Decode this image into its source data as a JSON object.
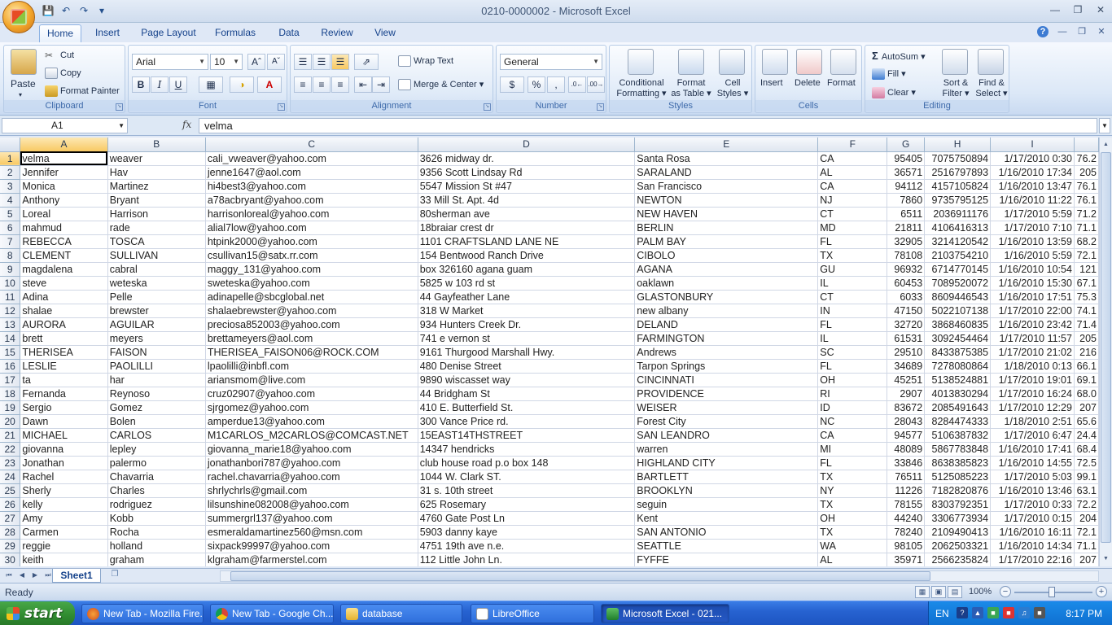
{
  "window": {
    "title": "0210-0000002 - Microsoft Excel"
  },
  "tabs": [
    "Home",
    "Insert",
    "Page Layout",
    "Formulas",
    "Data",
    "Review",
    "View"
  ],
  "ribbon": {
    "clipboard": {
      "label": "Clipboard",
      "paste": "Paste",
      "cut": "Cut",
      "copy": "Copy",
      "format_painter": "Format Painter"
    },
    "font": {
      "label": "Font",
      "font_name": "Arial",
      "font_size": "10",
      "bold": "B",
      "italic": "I",
      "underline": "U"
    },
    "alignment": {
      "label": "Alignment",
      "wrap_text": "Wrap Text",
      "merge_center": "Merge & Center"
    },
    "number": {
      "label": "Number",
      "format": "General",
      "currency": "$",
      "percent": "%",
      "comma": ","
    },
    "styles": {
      "label": "Styles",
      "conditional_1": "Conditional",
      "conditional_2": "Formatting",
      "format_table_1": "Format",
      "format_table_2": "as Table",
      "cell_styles_1": "Cell",
      "cell_styles_2": "Styles"
    },
    "cells": {
      "label": "Cells",
      "insert": "Insert",
      "delete": "Delete",
      "format": "Format"
    },
    "editing": {
      "label": "Editing",
      "autosum": "AutoSum",
      "fill": "Fill",
      "clear": "Clear",
      "sort_1": "Sort &",
      "sort_2": "Filter",
      "find_1": "Find &",
      "find_2": "Select"
    }
  },
  "formula_bar": {
    "name_box": "A1",
    "fx": "fx",
    "value": "velma"
  },
  "columns": [
    "A",
    "B",
    "C",
    "D",
    "E",
    "F",
    "G",
    "H",
    "I",
    ""
  ],
  "rows": [
    [
      "velma",
      "weaver",
      "cali_vweaver@yahoo.com",
      "3626 midway dr.",
      "Santa Rosa",
      "CA",
      "95405",
      "7075750894",
      "1/17/2010 0:30",
      "76.2"
    ],
    [
      "Jennifer",
      "Hav",
      "jenne1647@aol.com",
      "9356 Scott Lindsay Rd",
      "SARALAND",
      "AL",
      "36571",
      "2516797893",
      "1/16/2010 17:34",
      "205"
    ],
    [
      "Monica",
      "Martinez",
      "hi4best3@yahoo.com",
      "5547 Mission St #47",
      "San Francisco",
      "CA",
      "94112",
      "4157105824",
      "1/16/2010 13:47",
      "76.1"
    ],
    [
      "Anthony",
      "Bryant",
      "a78acbryant@yahoo.com",
      "33 Mill St. Apt. 4d",
      "NEWTON",
      "NJ",
      "7860",
      "9735795125",
      "1/16/2010 11:22",
      "76.1"
    ],
    [
      "Loreal",
      "Harrison",
      "harrisonloreal@yahoo.com",
      "80sherman ave",
      "NEW HAVEN",
      "CT",
      "6511",
      "2036911176",
      "1/17/2010 5:59",
      "71.2"
    ],
    [
      "mahmud",
      "rade",
      "alial7low@yahoo.com",
      "18braiar crest dr",
      "BERLIN",
      "MD",
      "21811",
      "4106416313",
      "1/17/2010 7:10",
      "71.1"
    ],
    [
      "REBECCA",
      "TOSCA",
      "htpink2000@yahoo.com",
      "1101 CRAFTSLAND LANE NE",
      "PALM BAY",
      "FL",
      "32905",
      "3214120542",
      "1/16/2010 13:59",
      "68.2"
    ],
    [
      "CLEMENT",
      "SULLIVAN",
      "csullivan15@satx.rr.com",
      "154 Bentwood Ranch Drive",
      "CIBOLO",
      "TX",
      "78108",
      "2103754210",
      "1/16/2010 5:59",
      "72.1"
    ],
    [
      "magdalena",
      "cabral",
      "maggy_131@yahoo.com",
      "box 326160 agana guam",
      "AGANA",
      "GU",
      "96932",
      "6714770145",
      "1/16/2010 10:54",
      "121"
    ],
    [
      "steve",
      "weteska",
      "sweteska@yahoo.com",
      "5825 w 103 rd st",
      "oaklawn",
      "IL",
      "60453",
      "7089520072",
      "1/16/2010 15:30",
      "67.1"
    ],
    [
      "Adina",
      "Pelle",
      "adinapelle@sbcglobal.net",
      "44 Gayfeather Lane",
      "GLASTONBURY",
      "CT",
      "6033",
      "8609446543",
      "1/16/2010 17:51",
      "75.3"
    ],
    [
      "shalae",
      "brewster",
      "shalaebrewster@yahoo.com",
      "318 W Market",
      "new albany",
      "IN",
      "47150",
      "5022107138",
      "1/17/2010 22:00",
      "74.1"
    ],
    [
      "AURORA",
      "AGUILAR",
      "preciosa852003@yahoo.com",
      "934 Hunters Creek Dr.",
      "DELAND",
      "FL",
      "32720",
      "3868460835",
      "1/16/2010 23:42",
      "71.4"
    ],
    [
      "brett",
      "meyers",
      "brettameyers@aol.com",
      "741 e vernon st",
      "FARMINGTON",
      "IL",
      "61531",
      "3092454464",
      "1/17/2010 11:57",
      "205"
    ],
    [
      "THERISEA",
      "FAISON",
      "THERISEA_FAISON06@ROCK.COM",
      "9161 Thurgood Marshall Hwy.",
      "Andrews",
      "SC",
      "29510",
      "8433875385",
      "1/17/2010 21:02",
      "216"
    ],
    [
      "LESLIE",
      "PAOLILLI",
      "lpaolilli@inbfl.com",
      "480 Denise Street",
      "Tarpon Springs",
      "FL",
      "34689",
      "7278080864",
      "1/18/2010 0:13",
      "66.1"
    ],
    [
      "ta",
      "har",
      "ariansmom@live.com",
      "9890 wiscasset way",
      "CINCINNATI",
      "OH",
      "45251",
      "5138524881",
      "1/17/2010 19:01",
      "69.1"
    ],
    [
      "Fernanda",
      "Reynoso",
      "cruz02907@yahoo.com",
      "44 Bridgham St",
      "PROVIDENCE",
      "RI",
      "2907",
      "4013830294",
      "1/17/2010 16:24",
      "68.0"
    ],
    [
      "Sergio",
      "Gomez",
      "sjrgomez@yahoo.com",
      "410 E. Butterfield St.",
      "WEISER",
      "ID",
      "83672",
      "2085491643",
      "1/17/2010 12:29",
      "207"
    ],
    [
      "Dawn",
      "Bolen",
      "amperdue13@yahoo.com",
      "300 Vance Price rd.",
      "Forest City",
      "NC",
      "28043",
      "8284474333",
      "1/18/2010 2:51",
      "65.6"
    ],
    [
      "MICHAEL",
      "CARLOS",
      "M1CARLOS_M2CARLOS@COMCAST.NET",
      "15EAST14THSTREET",
      "SAN LEANDRO",
      "CA",
      "94577",
      "5106387832",
      "1/17/2010 6:47",
      "24.4"
    ],
    [
      "giovanna",
      "lepley",
      "giovanna_marie18@yahoo.com",
      "14347 hendricks",
      "warren",
      "MI",
      "48089",
      "5867783848",
      "1/16/2010 17:41",
      "68.4"
    ],
    [
      "Jonathan",
      "palermo",
      "jonathanbori787@yahoo.com",
      "club house road p.o box 148",
      "HIGHLAND CITY",
      "FL",
      "33846",
      "8638385823",
      "1/16/2010 14:55",
      "72.5"
    ],
    [
      "Rachel",
      "Chavarria",
      "rachel.chavarria@yahoo.com",
      "1044 W. Clark ST.",
      "BARTLETT",
      "TX",
      "76511",
      "5125085223",
      "1/17/2010 5:03",
      "99.1"
    ],
    [
      "Sherly",
      "Charles",
      "shrlychrls@gmail.com",
      "31 s. 10th street",
      "BROOKLYN",
      "NY",
      "11226",
      "7182820876",
      "1/16/2010 13:46",
      "63.1"
    ],
    [
      "kelly",
      "rodriguez",
      "lilsunshine082008@yahoo.com",
      "625 Rosemary",
      "seguin",
      "TX",
      "78155",
      "8303792351",
      "1/17/2010 0:33",
      "72.2"
    ],
    [
      "Amy",
      "Kobb",
      "summergrl137@yahoo.com",
      "4760 Gate Post Ln",
      "Kent",
      "OH",
      "44240",
      "3306773934",
      "1/17/2010 0:15",
      "204"
    ],
    [
      "Carmen",
      "Rocha",
      "esmeraldamartinez560@msn.com",
      "5903 danny kaye",
      "SAN ANTONIO",
      "TX",
      "78240",
      "2109490413",
      "1/16/2010 16:11",
      "72.1"
    ],
    [
      "reggie",
      "holland",
      "sixpack99997@yahoo.com",
      "4751 19th ave n.e.",
      "SEATTLE",
      "WA",
      "98105",
      "2062503321",
      "1/16/2010 14:34",
      "71.1"
    ],
    [
      "keith",
      "graham",
      "klgraham@farmerstel.com",
      "112 Little John Ln.",
      "FYFFE",
      "AL",
      "35971",
      "2566235824",
      "1/17/2010 22:16",
      "207"
    ]
  ],
  "sheet": {
    "tab": "Sheet1"
  },
  "status": {
    "ready": "Ready",
    "zoom": "100%"
  },
  "taskbar": {
    "start": "start",
    "tasks": [
      "New Tab - Mozilla Fire...",
      "New Tab - Google Ch...",
      "database",
      "LibreOffice",
      "Microsoft Excel - 021..."
    ],
    "lang": "EN",
    "clock": "8:17 PM"
  }
}
